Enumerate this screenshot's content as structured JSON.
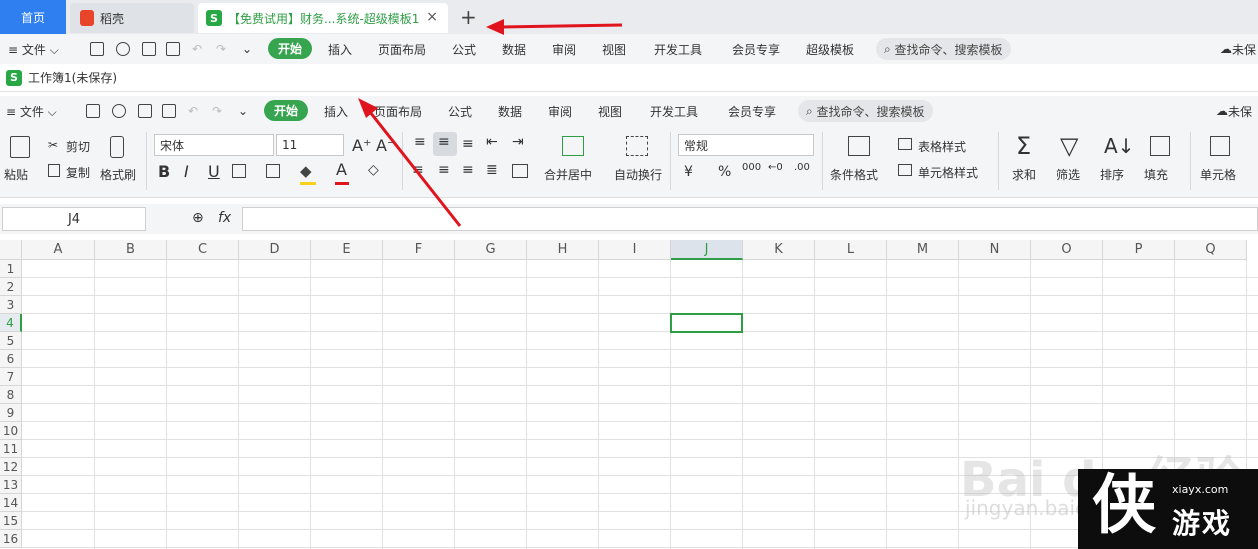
{
  "outer_tabs": {
    "home": "首页",
    "daoke": "稻壳",
    "doc_icon": "S",
    "doc_title": "【免费试用】财务...系统-超级模板1",
    "close": "×",
    "add": "+"
  },
  "outer_ribbon": {
    "file": "≡ 文件 ⌵",
    "tabs": [
      "开始",
      "插入",
      "页面布局",
      "公式",
      "数据",
      "审阅",
      "视图",
      "开发工具",
      "会员专享",
      "超级模板"
    ],
    "search": "查找命令、搜索模板",
    "right": "未保"
  },
  "title_row": {
    "icon": "S",
    "title": "工作簿1(未保存)"
  },
  "inner_ribbon": {
    "file": "≡ 文件 ⌵",
    "tabs": [
      "开始",
      "插入",
      "页面布局",
      "公式",
      "数据",
      "审阅",
      "视图",
      "开发工具",
      "会员专享"
    ],
    "search": "查找命令、搜索模板",
    "right": "未保"
  },
  "toolbar": {
    "paste": "粘贴",
    "cut": "剪切",
    "copy": "复制",
    "format_painter": "格式刷",
    "font_name": "宋体",
    "font_size": "11",
    "bold": "B",
    "italic": "I",
    "underline": "U",
    "merge_center": "合并居中",
    "wrap_text": "自动换行",
    "number_format": "常规",
    "currency": "¥",
    "percent": "%",
    "thousands": "000",
    "conditional_format": "条件格式",
    "table_style": "表格样式",
    "cell_style": "单元格样式",
    "sum": "求和",
    "filter": "筛选",
    "sort": "排序",
    "fill": "填充",
    "cell": "单元格"
  },
  "formula_bar": {
    "cell_ref": "J4",
    "fx": "fx",
    "formula": ""
  },
  "sheet": {
    "columns": [
      "A",
      "B",
      "C",
      "D",
      "E",
      "F",
      "G",
      "H",
      "I",
      "J",
      "K",
      "L",
      "M",
      "N",
      "O",
      "P",
      "Q"
    ],
    "rows": [
      "1",
      "2",
      "3",
      "4",
      "5",
      "6",
      "7",
      "8",
      "9",
      "10",
      "11",
      "12",
      "13",
      "14",
      "15",
      "16"
    ],
    "active_column": "J",
    "active_row": "4"
  },
  "watermark": {
    "baidu": "Bai du 经验",
    "jingyan": "jingyan.baidu.com",
    "site": "xiayx.com",
    "game": "游戏",
    "logo": "侠"
  },
  "colors": {
    "accent_green": "#37a550",
    "home_blue": "#2f7ff0",
    "arrow_red": "#e0141d"
  }
}
